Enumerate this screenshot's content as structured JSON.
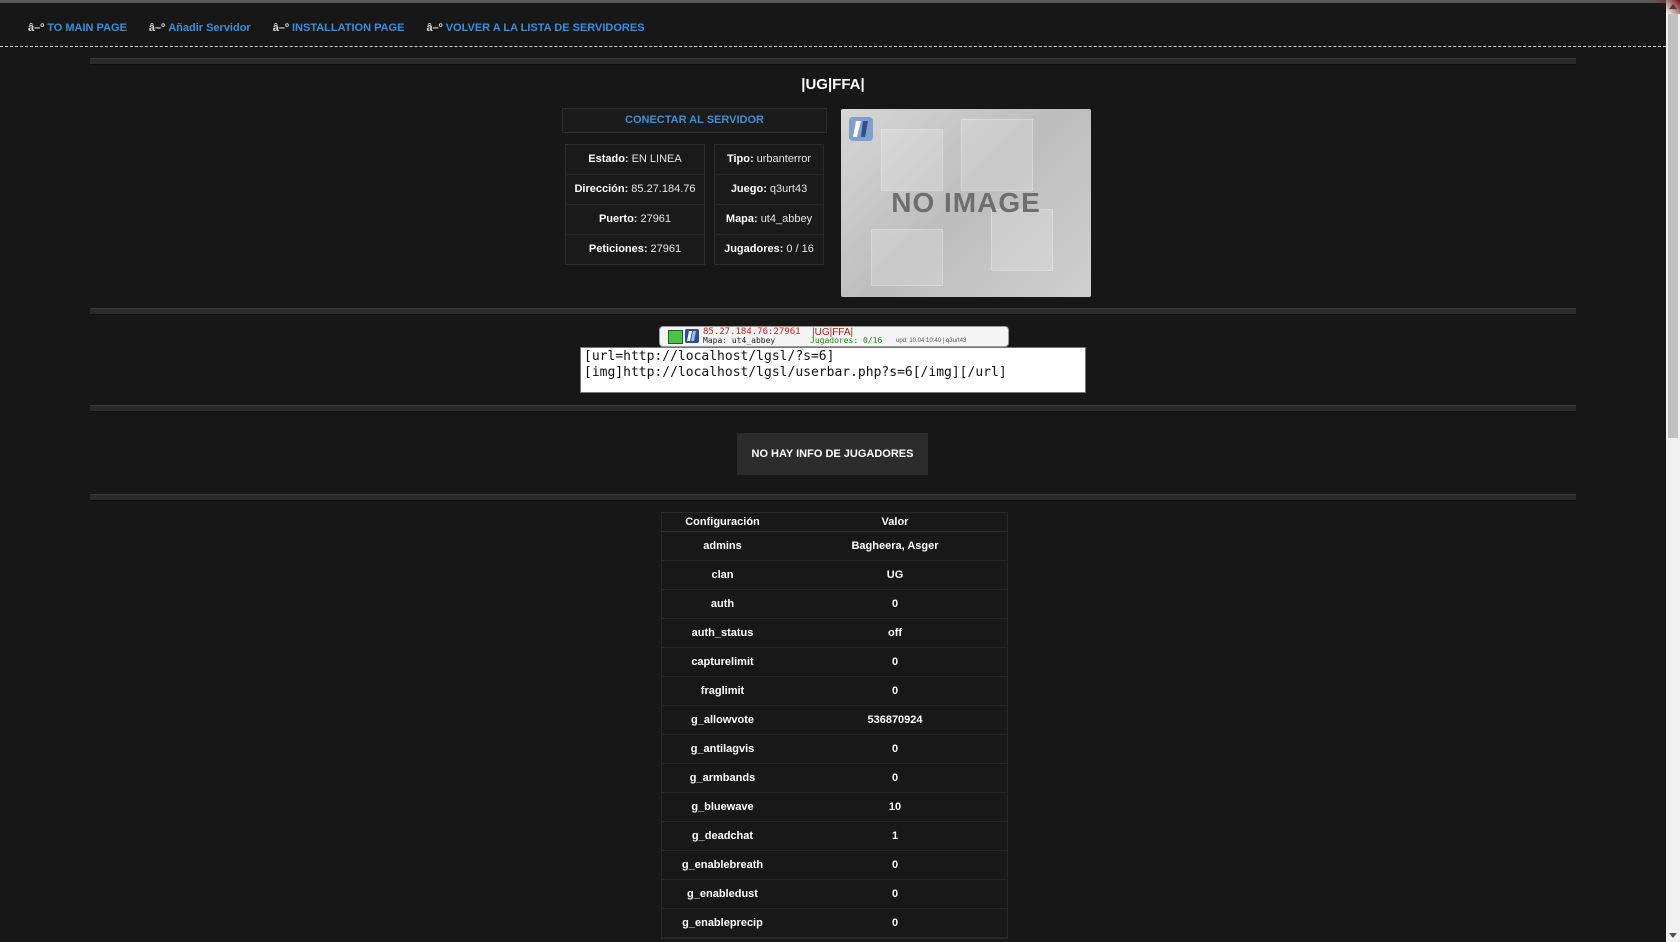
{
  "nav": {
    "prefix": "â–º",
    "items": [
      "TO MAIN PAGE",
      "Añadir Servidor",
      "INSTALLATION PAGE",
      "VOLVER A LA LISTA DE SERVIDORES"
    ]
  },
  "server": {
    "title": "|UG|FFA|",
    "connect_label": "CONECTAR AL SERVIDOR",
    "left_info": [
      {
        "key": "Estado:",
        "value": "EN LINEA"
      },
      {
        "key": "Dirección:",
        "value": "85.27.184.76"
      },
      {
        "key": "Puerto:",
        "value": "27961"
      },
      {
        "key": "Peticiones:",
        "value": "27961"
      }
    ],
    "right_info": [
      {
        "key": "Tipo:",
        "value": "urbanterror"
      },
      {
        "key": "Juego:",
        "value": "q3urt43"
      },
      {
        "key": "Mapa:",
        "value": "ut4_abbey"
      },
      {
        "key": "Jugadores:",
        "value": "0 / 16"
      }
    ],
    "map_image_text": "NO IMAGE"
  },
  "userbar": {
    "ip": "85.27.184.76:27961",
    "map": "Mapa: ut4_abbey",
    "name": "|UG|FFA|",
    "players": "Jugadores: 0/16",
    "updated": "upd: 10.04 10:40 | q3urt43"
  },
  "bbcode": {
    "line1": "[url=http://localhost/lgsl/?s=6]",
    "line2": "[img]http://localhost/lgsl/userbar.php?s=6[/img][/url]"
  },
  "players_notice": "NO HAY INFO DE JUGADORES",
  "config": {
    "header": {
      "setting": "Configuración",
      "value": "Valor"
    },
    "rows": [
      {
        "k": "admins",
        "v": "Bagheera, Asger"
      },
      {
        "k": "clan",
        "v": "UG"
      },
      {
        "k": "auth",
        "v": "0"
      },
      {
        "k": "auth_status",
        "v": "off"
      },
      {
        "k": "capturelimit",
        "v": "0"
      },
      {
        "k": "fraglimit",
        "v": "0"
      },
      {
        "k": "g_allowvote",
        "v": "536870924"
      },
      {
        "k": "g_antilagvis",
        "v": "0"
      },
      {
        "k": "g_armbands",
        "v": "0"
      },
      {
        "k": "g_bluewave",
        "v": "10"
      },
      {
        "k": "g_deadchat",
        "v": "1"
      },
      {
        "k": "g_enablebreath",
        "v": "0"
      },
      {
        "k": "g_enabledust",
        "v": "0"
      },
      {
        "k": "g_enableprecip",
        "v": "0"
      }
    ]
  }
}
